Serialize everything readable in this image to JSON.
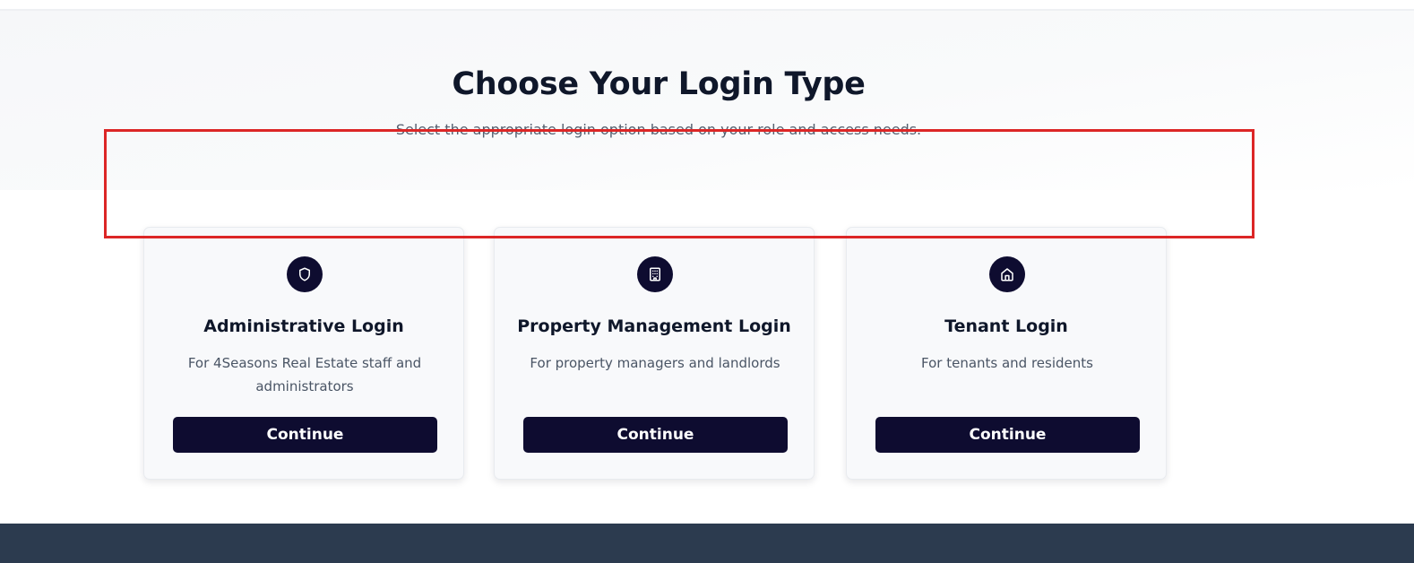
{
  "header": {
    "title": "Choose Your Login Type",
    "subtitle": "Select the appropriate login option based on your role and access needs."
  },
  "cards": [
    {
      "icon": "shield-icon",
      "title": "Administrative Login",
      "description": "For 4Seasons Real Estate staff and administrators",
      "button_label": "Continue"
    },
    {
      "icon": "building-icon",
      "title": "Property Management Login",
      "description": "For property managers and landlords",
      "button_label": "Continue"
    },
    {
      "icon": "home-icon",
      "title": "Tenant Login",
      "description": "For tenants and residents",
      "button_label": "Continue"
    }
  ],
  "colors": {
    "primary": "#0e0c30",
    "highlight_border": "#dc2626",
    "footer": "#2c3b4f",
    "card_background": "#f8f9fb"
  }
}
